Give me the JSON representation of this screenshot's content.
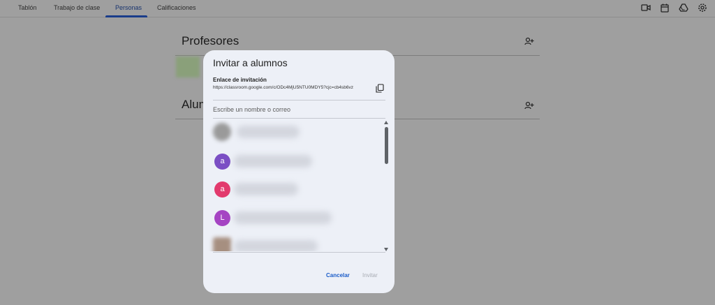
{
  "tabs": [
    {
      "label": "Tablón"
    },
    {
      "label": "Trabajo de clase"
    },
    {
      "label": "Personas",
      "active": true
    },
    {
      "label": "Calificaciones"
    }
  ],
  "top_icons": [
    "video-icon",
    "calendar-icon",
    "drive-icon",
    "settings-icon"
  ],
  "sections": {
    "teachers_title": "Profesores",
    "students_title_partial": "Alum"
  },
  "modal": {
    "title": "Invitar a alumnos",
    "link_label": "Enlace de invitación",
    "link_url": "https://classroom.google.com/c/ODc4MjU5NTU0MDY5?cjc=cb4sb6vz",
    "search_placeholder": "Escribe un nombre o correo",
    "avatars": [
      {
        "letter": "",
        "color": "#9a9a9a",
        "blurred": true
      },
      {
        "letter": "a",
        "color": "#7b4fc4"
      },
      {
        "letter": "a",
        "color": "#e23a6d"
      },
      {
        "letter": "L",
        "color": "#a544c3"
      },
      {
        "letter": "",
        "color": "#a68f80",
        "blurred": true
      }
    ],
    "cancel_label": "Cancelar",
    "invite_label": "Invitar"
  }
}
